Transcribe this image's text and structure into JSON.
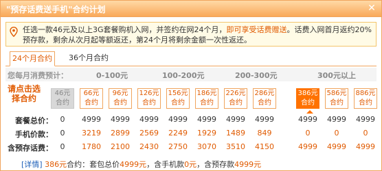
{
  "window": {
    "title": "\"预存话费送手机\"合约计划",
    "close_glyph": "✕"
  },
  "notice": {
    "part1": "任选一款46元及以上3G套餐购机入网，并签约在网24个月，",
    "highlight": "即可享受话费赠送",
    "part2": "。话费入网首月返约20%预存款，剩余从次月起等额返还，第24个月将剩余金额一次性返还。"
  },
  "tabs": [
    {
      "label": "24个月合约",
      "active": true
    },
    {
      "label": "36个月合约",
      "active": false
    }
  ],
  "consumption": {
    "label": "您每月消费预计：",
    "ranges": [
      "0-100元",
      "100-200元",
      "200-300元",
      "300元以上"
    ]
  },
  "pick_label": "请点击选择合约",
  "plans": [
    {
      "top": "46元",
      "bottom": "合约",
      "state": "disabled"
    },
    {
      "top": "66元",
      "bottom": "合约",
      "state": "normal"
    },
    {
      "top": "96元",
      "bottom": "合约",
      "state": "normal"
    },
    {
      "top": "126元",
      "bottom": "合约",
      "state": "normal"
    },
    {
      "top": "156元",
      "bottom": "合约",
      "state": "normal"
    },
    {
      "top": "186元",
      "bottom": "合约",
      "state": "normal"
    },
    {
      "top": "226元",
      "bottom": "合约",
      "state": "normal"
    },
    {
      "top": "286元",
      "bottom": "合约",
      "state": "normal"
    },
    {
      "top": "386元",
      "bottom": "合约",
      "state": "selected"
    },
    {
      "top": "586元",
      "bottom": "合约",
      "state": "normal"
    },
    {
      "top": "886元",
      "bottom": "合约",
      "state": "normal"
    }
  ],
  "table": [
    {
      "label": "套餐总价：",
      "values": [
        "0",
        "4999",
        "4999",
        "4999",
        "4999",
        "4999",
        "4999",
        "4999",
        "4999",
        "4999",
        "4999"
      ]
    },
    {
      "label": "手机价款：",
      "values": [
        "0",
        "3219",
        "2899",
        "2569",
        "2249",
        "1929",
        "1489",
        "849",
        "0",
        "0",
        "0"
      ]
    },
    {
      "label": "含预存话费：",
      "values": [
        "0",
        "1780",
        "2100",
        "2430",
        "2750",
        "3070",
        "3510",
        "4150",
        "4999",
        "4999",
        "4999"
      ]
    }
  ],
  "footer": {
    "link": "[详情]",
    "plan": "386元",
    "t1": "合约：套包总价",
    "total": "4999元",
    "t2": "，含手机款",
    "phone": "0元",
    "t3": "，含预存款",
    "prepaid": "4999元"
  },
  "colors": {
    "accent": "#ff7200",
    "border": "#f0a45c",
    "link": "#1d5fb8"
  }
}
